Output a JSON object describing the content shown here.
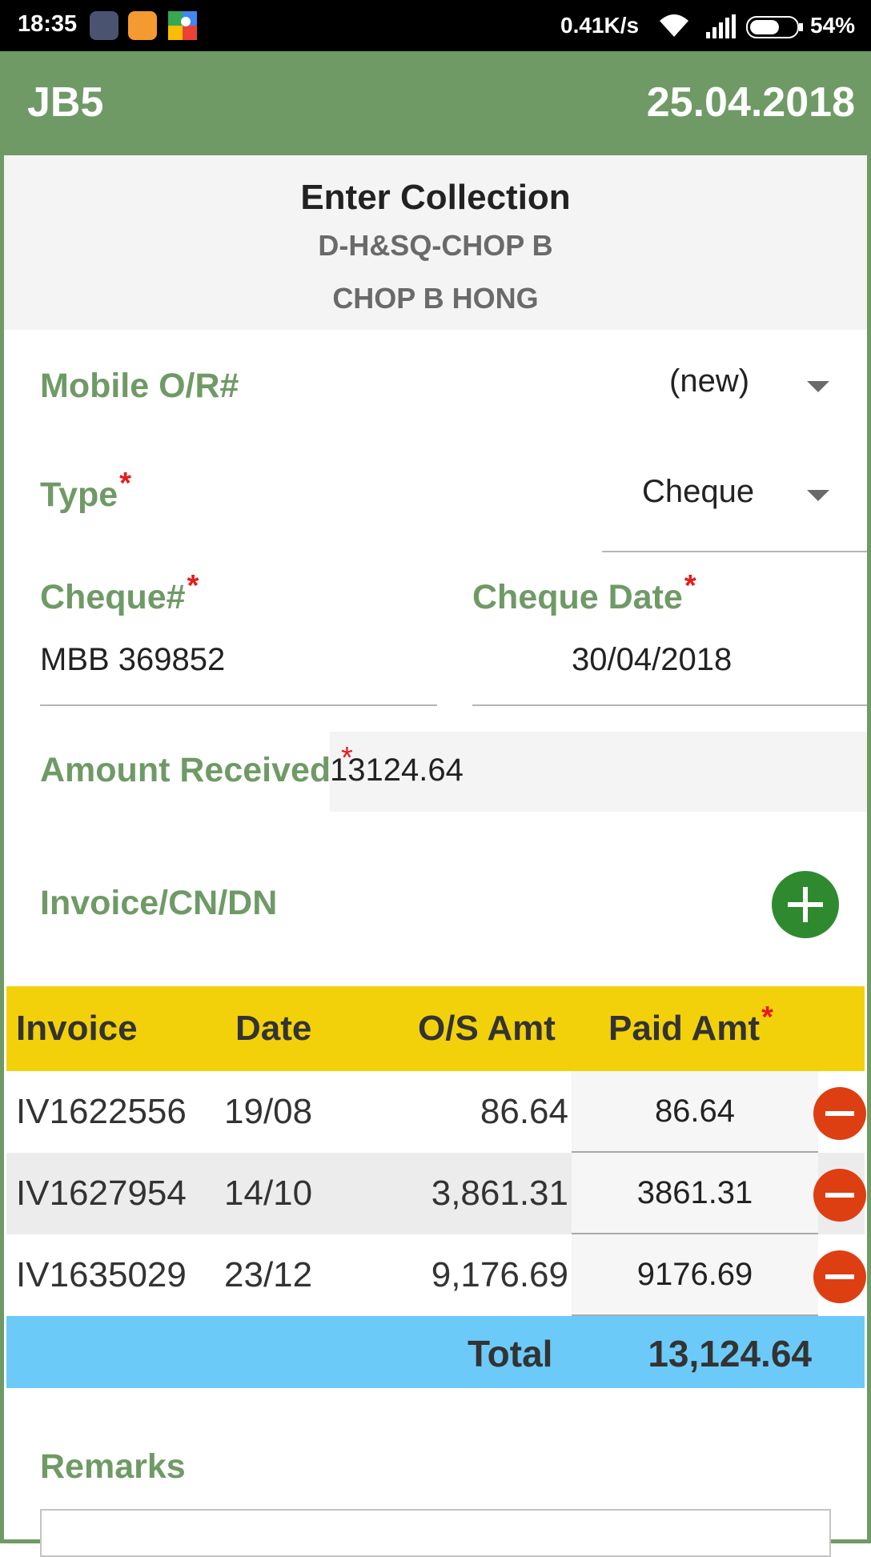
{
  "status_bar": {
    "time": "18:35",
    "network_speed": "0.41K/s",
    "battery": "54%",
    "app_icons": [
      "screen-recorder-icon",
      "orange-app-icon",
      "maps-icon"
    ]
  },
  "header": {
    "code": "JB5",
    "date": "25.04.2018",
    "color": "#6f9a66"
  },
  "title_block": {
    "title": "Enter Collection",
    "subtitle1": "D-H&SQ-CHOP B",
    "subtitle2": "CHOP B HONG"
  },
  "form": {
    "mobile_or": {
      "label": "Mobile O/R#",
      "value": "(new)"
    },
    "type": {
      "label": "Type",
      "required": "*",
      "value": "Cheque"
    },
    "cheque_no": {
      "label": "Cheque#",
      "required": "*",
      "value": "MBB 369852"
    },
    "cheque_date": {
      "label": "Cheque Date",
      "required": "*",
      "value": "30/04/2018"
    },
    "amount_received": {
      "label": "Amount Received",
      "required": "*",
      "value": "13124.64"
    }
  },
  "invoices": {
    "section_label": "Invoice/CN/DN",
    "columns": {
      "invoice": "Invoice",
      "date": "Date",
      "os_amt": "O/S Amt",
      "paid_amt": "Paid Amt",
      "required": "*"
    },
    "rows": [
      {
        "invoice": "IV1622556",
        "date": "19/08",
        "os_amt": "86.64",
        "paid_amt": "86.64"
      },
      {
        "invoice": "IV1627954",
        "date": "14/10",
        "os_amt": "3,861.31",
        "paid_amt": "3861.31"
      },
      {
        "invoice": "IV1635029",
        "date": "23/12",
        "os_amt": "9,176.69",
        "paid_amt": "9176.69"
      }
    ],
    "total_label": "Total",
    "total_value": "13,124.64",
    "header_color": "#f2d10a",
    "total_color": "#6ccaf8"
  },
  "remarks": {
    "label": "Remarks",
    "value": ""
  }
}
